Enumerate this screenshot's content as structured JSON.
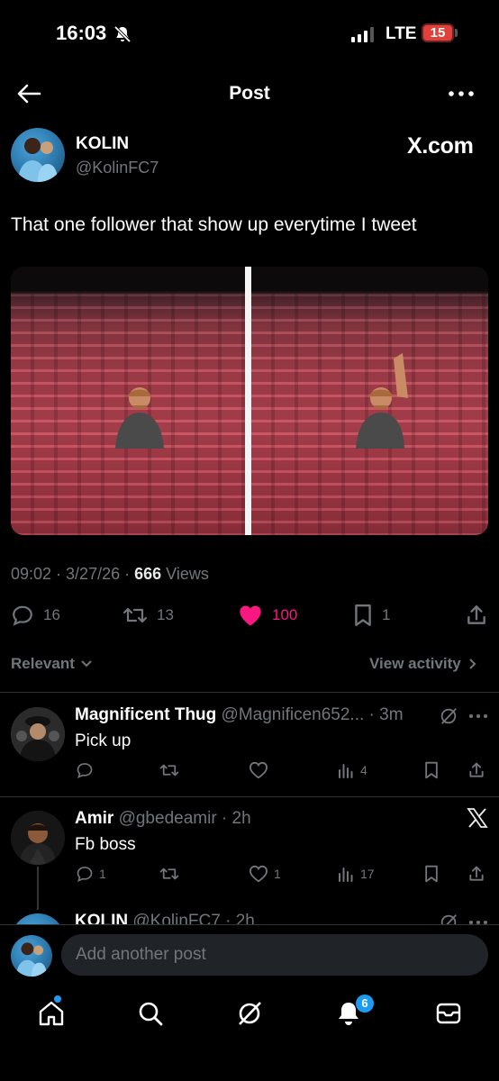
{
  "status_bar": {
    "time": "16:03",
    "network": "LTE",
    "battery": "15"
  },
  "header": {
    "title": "Post"
  },
  "post": {
    "author_name": "KOLIN",
    "author_handle": "@KolinFC7",
    "brand": "X.com",
    "text": "That one follower that show up everytime I tweet",
    "time": "09:02",
    "date": "3/27/26",
    "views_count": "666",
    "views_label": "Views",
    "replies": "16",
    "reposts": "13",
    "likes": "100",
    "bookmarks": "1"
  },
  "sort": {
    "label": "Relevant",
    "view_activity": "View activity"
  },
  "replies": [
    {
      "name": "Magnificent Thug",
      "handle": "@Magnificen652...",
      "time": "3m",
      "text": "Pick up",
      "replies": "",
      "reposts": "",
      "likes": "",
      "views": "4"
    },
    {
      "name": "Amir",
      "handle": "@gbedeamir",
      "time": "2h",
      "text": "Fb boss",
      "replies": "1",
      "reposts": "",
      "likes": "1",
      "views": "17"
    },
    {
      "name": "KOLIN",
      "handle": "@KolinFC7",
      "time": "2h"
    }
  ],
  "composer": {
    "placeholder": "Add another post"
  },
  "tabbar": {
    "notifications_badge": "6"
  },
  "colors": {
    "like": "#f91880",
    "accent": "#1d9bf0",
    "muted": "#71767b",
    "battery": "#e0413b"
  }
}
